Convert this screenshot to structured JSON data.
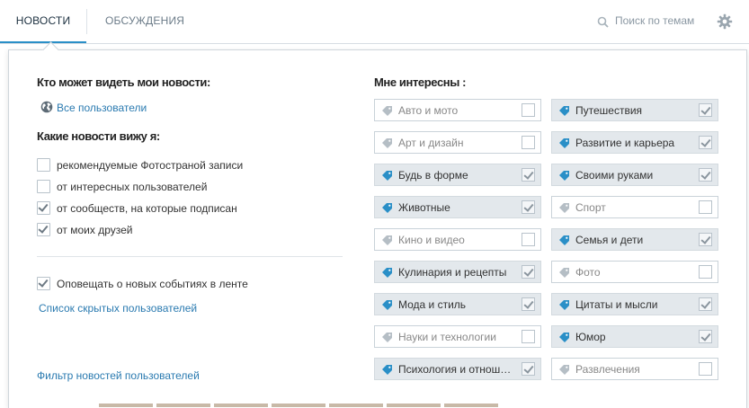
{
  "tabs": [
    {
      "label": "НОВОСТИ",
      "active": true
    },
    {
      "label": "ОБСУЖДЕНИЯ",
      "active": false
    }
  ],
  "search": {
    "placeholder": "Поиск по темам",
    "icon": "search-icon"
  },
  "settings_icon": "gear-icon",
  "privacy": {
    "heading": "Кто может видеть мои новости:",
    "value": "Все пользователи",
    "icon": "globe-icon"
  },
  "feed": {
    "heading": "Какие новости вижу я:",
    "options": [
      {
        "label": "рекомендуемые Фотостраной записи",
        "checked": false
      },
      {
        "label": "от интересных пользователей",
        "checked": false
      },
      {
        "label": "от сообществ, на которые подписан",
        "checked": true
      },
      {
        "label": "от моих друзей",
        "checked": true
      }
    ]
  },
  "notify": {
    "label": "Оповещать о новых событиях в ленте",
    "checked": true
  },
  "hidden_users_link": "Список скрытых пользователей",
  "filter_link": "Фильтр новостей пользователей",
  "interests": {
    "heading": "Мне интересны :",
    "left": [
      {
        "label": "Авто и мото",
        "checked": false
      },
      {
        "label": "Арт и дизайн",
        "checked": false
      },
      {
        "label": "Будь в форме",
        "checked": true
      },
      {
        "label": "Животные",
        "checked": true
      },
      {
        "label": "Кино и видео",
        "checked": false
      },
      {
        "label": "Кулинария и рецепты",
        "checked": true
      },
      {
        "label": "Мода и стиль",
        "checked": true
      },
      {
        "label": "Науки и технологии",
        "checked": false
      },
      {
        "label": "Психология и отнош…",
        "checked": true
      }
    ],
    "right": [
      {
        "label": "Путешествия",
        "checked": true
      },
      {
        "label": "Развитие и карьера",
        "checked": true
      },
      {
        "label": "Своими руками",
        "checked": true
      },
      {
        "label": "Спорт",
        "checked": false
      },
      {
        "label": "Семья и дети",
        "checked": true
      },
      {
        "label": "Фото",
        "checked": false
      },
      {
        "label": "Цитаты и мысли",
        "checked": true
      },
      {
        "label": "Юмор",
        "checked": true
      },
      {
        "label": "Развлечения",
        "checked": false
      }
    ]
  },
  "colors": {
    "accent": "#2a8fc7",
    "link": "#2a7ab0",
    "tag_icon_on": "#2a8fc7",
    "tag_icon_off": "#b5bec5"
  }
}
